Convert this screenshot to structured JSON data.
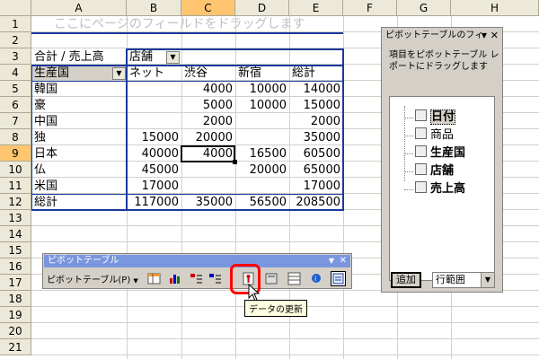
{
  "columns": [
    "A",
    "B",
    "C",
    "D",
    "E",
    "F",
    "G",
    "H"
  ],
  "rows": [
    "1",
    "2",
    "3",
    "4",
    "5",
    "6",
    "7",
    "8",
    "9",
    "10",
    "11",
    "12",
    "13",
    "14",
    "15",
    "16",
    "17",
    "18",
    "19",
    "20",
    "21"
  ],
  "pivot": {
    "page_drop_hint": "ここにページのフィールドをドラッグします",
    "data_field_label": "合計 / 売上高",
    "column_field": "店舗",
    "row_field": "生産国",
    "column_items": [
      "ネット",
      "渋谷",
      "新宿",
      "総計"
    ],
    "rows": [
      {
        "label": "韓国",
        "values": [
          "",
          "4000",
          "10000",
          "14000"
        ]
      },
      {
        "label": "豪",
        "values": [
          "",
          "5000",
          "10000",
          "15000"
        ]
      },
      {
        "label": "中国",
        "values": [
          "",
          "2000",
          "",
          "2000"
        ]
      },
      {
        "label": "独",
        "values": [
          "15000",
          "20000",
          "",
          "35000"
        ]
      },
      {
        "label": "日本",
        "values": [
          "40000",
          "4000",
          "16500",
          "60500"
        ]
      },
      {
        "label": "仏",
        "values": [
          "45000",
          "",
          "20000",
          "65000"
        ]
      },
      {
        "label": "米国",
        "values": [
          "17000",
          "",
          "",
          "17000"
        ]
      },
      {
        "label": "総計",
        "values": [
          "117000",
          "35000",
          "56500",
          "208500"
        ]
      }
    ]
  },
  "field_list": {
    "title": "ピボットテーブルのフィ",
    "instructions": [
      "項目をピボットテーブル レ",
      "ポートにドラッグします"
    ],
    "fields": [
      {
        "name": "日付",
        "bold": true,
        "selected": true
      },
      {
        "name": "商品",
        "bold": false,
        "selected": false
      },
      {
        "name": "生産国",
        "bold": true,
        "selected": false
      },
      {
        "name": "店舗",
        "bold": true,
        "selected": false
      },
      {
        "name": "売上高",
        "bold": true,
        "selected": false
      }
    ],
    "add_button": "追加",
    "area_select": "行範囲"
  },
  "toolbar": {
    "title": "ピボットテーブル",
    "menu_label": "ピボットテーブル(P)",
    "tooltip": "データの更新"
  },
  "colors": {
    "highlight": "#ff0000",
    "pivot_border": "#1a3a9a"
  }
}
